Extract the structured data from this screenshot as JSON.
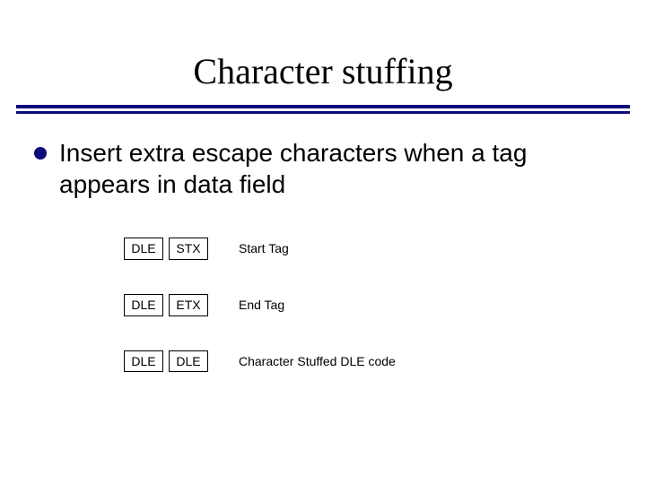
{
  "title": "Character stuffing",
  "bullet": "Insert extra escape characters when a tag appears in data field",
  "legend": {
    "rows": [
      {
        "box1": "DLE",
        "box2": "STX",
        "label": "Start Tag"
      },
      {
        "box1": "DLE",
        "box2": "ETX",
        "label": "End Tag"
      },
      {
        "box1": "DLE",
        "box2": "DLE",
        "label": "Character Stuffed DLE code"
      }
    ]
  }
}
